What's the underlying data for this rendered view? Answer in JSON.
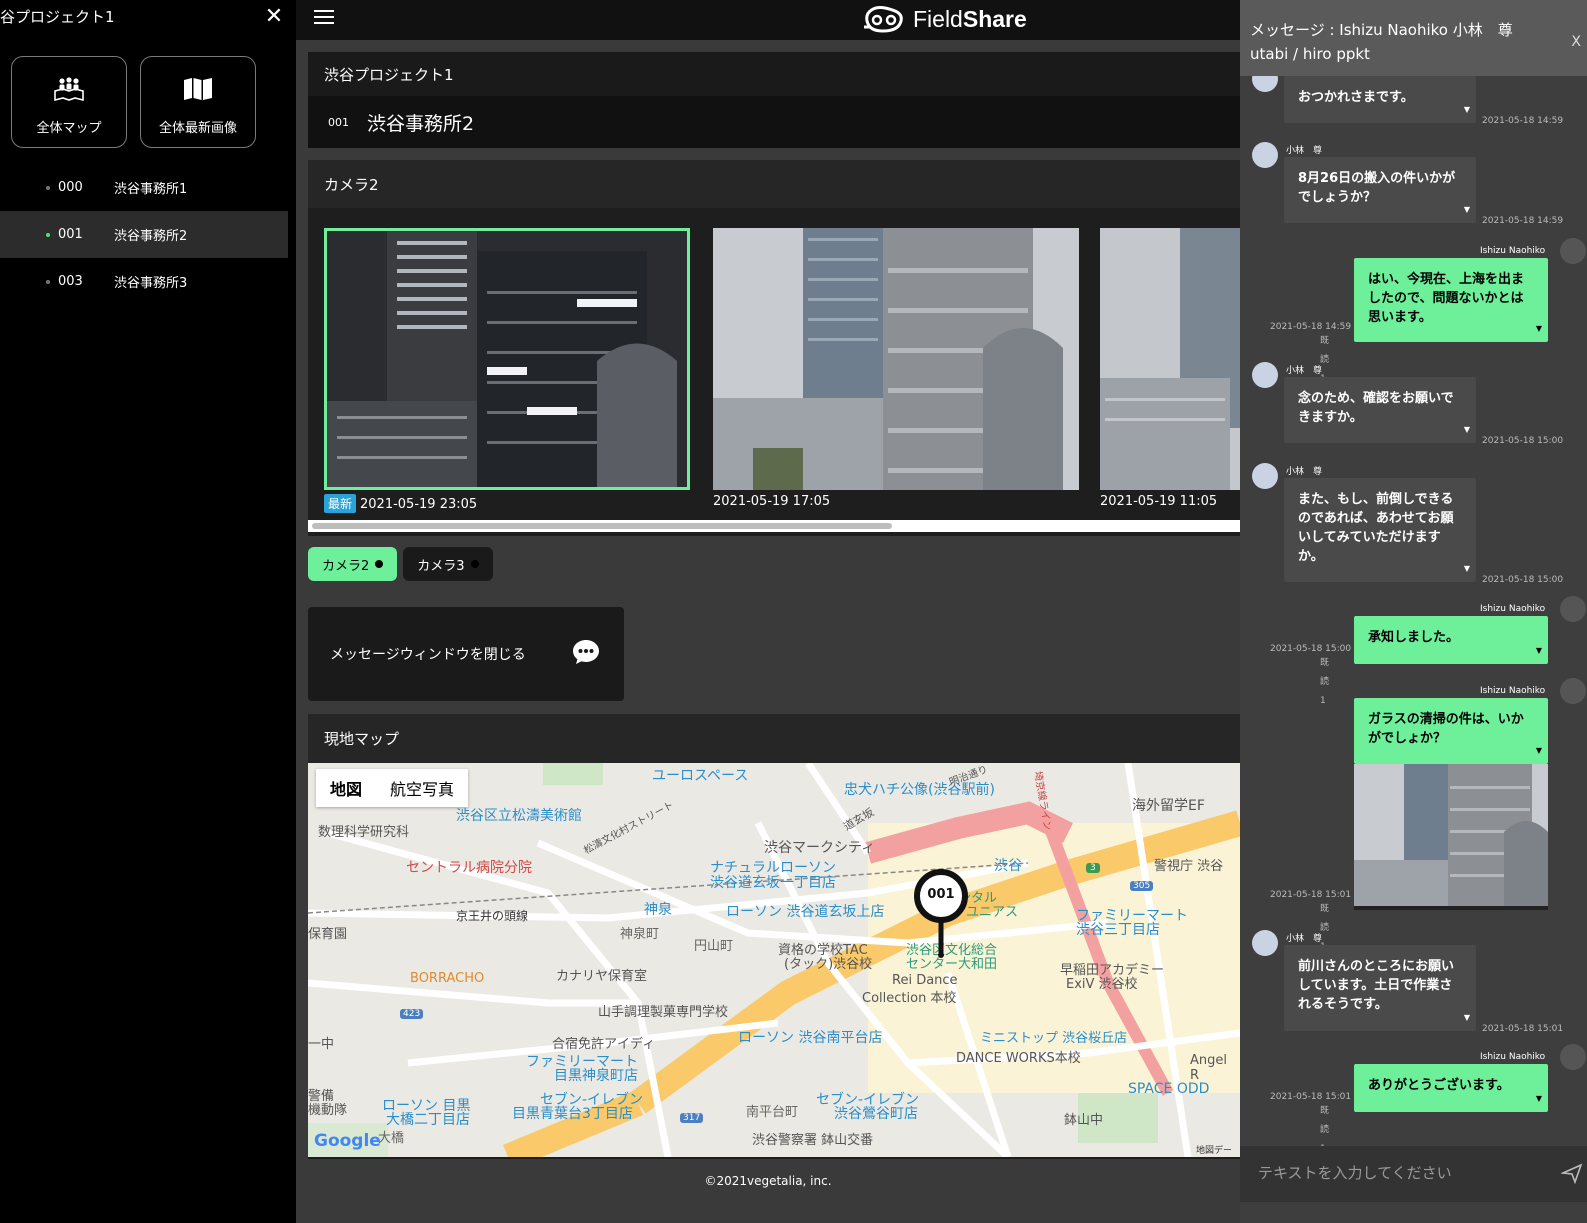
{
  "sidebar": {
    "title": "谷プロジェクト1",
    "buttons": [
      {
        "label": "全体マップ",
        "icon": "people-map-icon"
      },
      {
        "label": "全体最新画像",
        "icon": "folded-map-icon"
      }
    ],
    "items": [
      {
        "code": "000",
        "name": "渋谷事務所1",
        "active": false
      },
      {
        "code": "001",
        "name": "渋谷事務所2",
        "active": true
      },
      {
        "code": "003",
        "name": "渋谷事務所3",
        "active": false
      }
    ]
  },
  "header": {
    "logo_light": "Field",
    "logo_bold": "Share"
  },
  "main": {
    "project_title": "渋谷プロジェクト1",
    "site_code": "001",
    "site_name": "渋谷事務所2",
    "camera_title": "カメラ2",
    "thumbnails": [
      {
        "timestamp": "2021-05-19 23:05",
        "badge": "最新"
      },
      {
        "timestamp": "2021-05-19 17:05"
      },
      {
        "timestamp": "2021-05-19 11:05"
      }
    ],
    "camera_tabs": [
      "カメラ2",
      "カメラ3"
    ],
    "close_message_label": "メッセージウィンドウを閉じる",
    "map_title": "現地マップ",
    "map_tabs": [
      "地図",
      "航空写真"
    ],
    "map_marker": "001",
    "map_labels": {
      "l1": "ユーロスペース",
      "l2": "忠犬ハチ公像(渋谷駅前)",
      "l3": "渋谷区立松濤美術館",
      "l4": "海外留学EF",
      "l5": "数理科学研究科",
      "l6": "渋谷マークシティ",
      "l7": "セントラル病院分院",
      "l8": "ナチュラルローソン",
      "l9": "渋谷道玄坂一丁目店",
      "l10": "渋谷",
      "l11": "警視庁 渋谷",
      "l12": "京王井の頭線",
      "l13": "神泉",
      "l14": "ローソン 渋谷道玄坂上店",
      "l15": "ファミリーマート",
      "l16": "渋谷三丁目店",
      "l17": "神泉町",
      "l18": "円山町",
      "l19": "資格の学校TAC",
      "l20": "(タック)渋谷校",
      "l21": "渋谷区文化総合",
      "l22": "センター大和田",
      "l23": "早稲田アカデミー",
      "l24": "ExiV 渋谷校",
      "l25": "BORRACHO",
      "l26": "カナリヤ保育室",
      "l27": "Rei Dance",
      "l28": "Collection 本校",
      "l29": "山手調理製菓専門学校",
      "l30": "合宿免許アイディ",
      "l31": "ローソン 渋谷南平台店",
      "l32": "ミニストップ 渋谷桜丘店",
      "l33": "ファミリーマート",
      "l34": "目黒神泉町店",
      "l35": "DANCE WORKS本校",
      "l36": "Angel R",
      "l37": "ローソン 目黒",
      "l38": "大橋二丁目店",
      "l39": "セブン-イレブン",
      "l40": "目黒青葉台3丁目店",
      "l41": "セブン-イレブン",
      "l42": "渋谷鶯谷町店",
      "l43": "SPACE ODD",
      "l44": "南平台町",
      "l45": "鉢山中",
      "l46": "渋谷警察署 鉢山交番",
      "l47": "大橋",
      "l48": "Google",
      "l49": "地図デー",
      "l50": "保育園",
      "l51": "警備",
      "l52": "機動隊",
      "l53": "一中",
      "l54": "ンタル",
      "l55": "ユニアス",
      "l56": "道玄坂",
      "l57": "松濤文化村ストリート",
      "l58": "明治通り",
      "l59": "埼京線ライン",
      "r423": "423",
      "r317": "317",
      "r305": "305",
      "r3": "3"
    },
    "footer": "©2021vegetalia, inc."
  },
  "chat": {
    "title": "メッセージ : Ishizu Naohiko 小林　尊 utabi / hiro ppkt",
    "close": "X",
    "input_placeholder": "テキストを入力してください",
    "messages": [
      {
        "dir": "in",
        "text": "おつかれさまです。",
        "time": "2021-05-18 14:59"
      },
      {
        "dir": "in",
        "name": "小林　尊",
        "text": "8月26日の搬入の件いかがでしょうか？",
        "time": "2021-05-18 14:59"
      },
      {
        "dir": "out",
        "name": "Ishizu Naohiko",
        "text": "はい、今現在、上海を出ましたので、問題ないかとは思います。",
        "time": "2021-05-18 14:59",
        "read": "既読 1"
      },
      {
        "dir": "in",
        "name": "小林　尊",
        "text": "念のため、確認をお願いできますか。",
        "time": "2021-05-18 15:00"
      },
      {
        "dir": "in",
        "name": "小林　尊",
        "text": "また、もし、前倒しできるのであれば、あわせてお願いしてみていただけますか。",
        "time": "2021-05-18 15:00"
      },
      {
        "dir": "out",
        "name": "Ishizu Naohiko",
        "text": "承知しました。",
        "time": "2021-05-18 15:00",
        "read": "既読 1"
      },
      {
        "dir": "out",
        "name": "Ishizu Naohiko",
        "text": "ガラスの清掃の件は、いかがでしょか？",
        "time": "2021-05-18 15:01",
        "read": "既読 1"
      },
      {
        "dir": "in",
        "name": "小林　尊",
        "text": "前川さんのところにお願いしています。土日で作業されるそうです。",
        "time": "2021-05-18 15:01"
      },
      {
        "dir": "out",
        "name": "Ishizu Naohiko",
        "text": "ありがとうございます。",
        "time": "2021-05-18 15:01",
        "read": "既読 1"
      }
    ],
    "more_glyph": "▼"
  },
  "colors": {
    "accent_green": "#6ef09a",
    "badge_blue": "#29a3d9",
    "selected_border": "#6ef09a"
  }
}
